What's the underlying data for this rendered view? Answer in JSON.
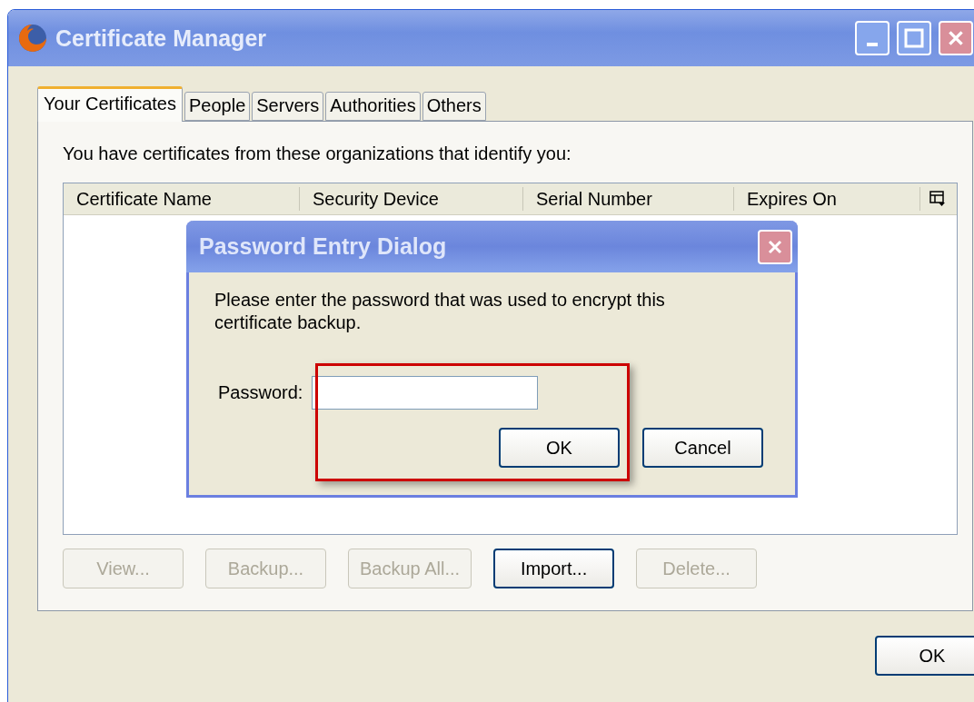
{
  "window": {
    "title": "Certificate Manager"
  },
  "tabs": [
    {
      "label": "Your Certificates",
      "selected": true
    },
    {
      "label": "People",
      "selected": false
    },
    {
      "label": "Servers",
      "selected": false
    },
    {
      "label": "Authorities",
      "selected": false
    },
    {
      "label": "Others",
      "selected": false
    }
  ],
  "panel": {
    "description": "You have certificates from these organizations that identify you:",
    "table": {
      "columns": [
        "Certificate Name",
        "Security Device",
        "Serial Number",
        "Expires On"
      ]
    },
    "buttons": [
      {
        "label": "View...",
        "disabled": true
      },
      {
        "label": "Backup...",
        "disabled": true
      },
      {
        "label": "Backup All...",
        "disabled": true
      },
      {
        "label": "Import...",
        "disabled": false
      },
      {
        "label": "Delete...",
        "disabled": true
      }
    ]
  },
  "dialog": {
    "title": "Password Entry Dialog",
    "message": "Please enter the password that was used to encrypt this certificate backup.",
    "field_label": "Password:",
    "buttons": [
      "OK",
      "Cancel"
    ]
  },
  "footer_buttons": [
    "OK"
  ]
}
